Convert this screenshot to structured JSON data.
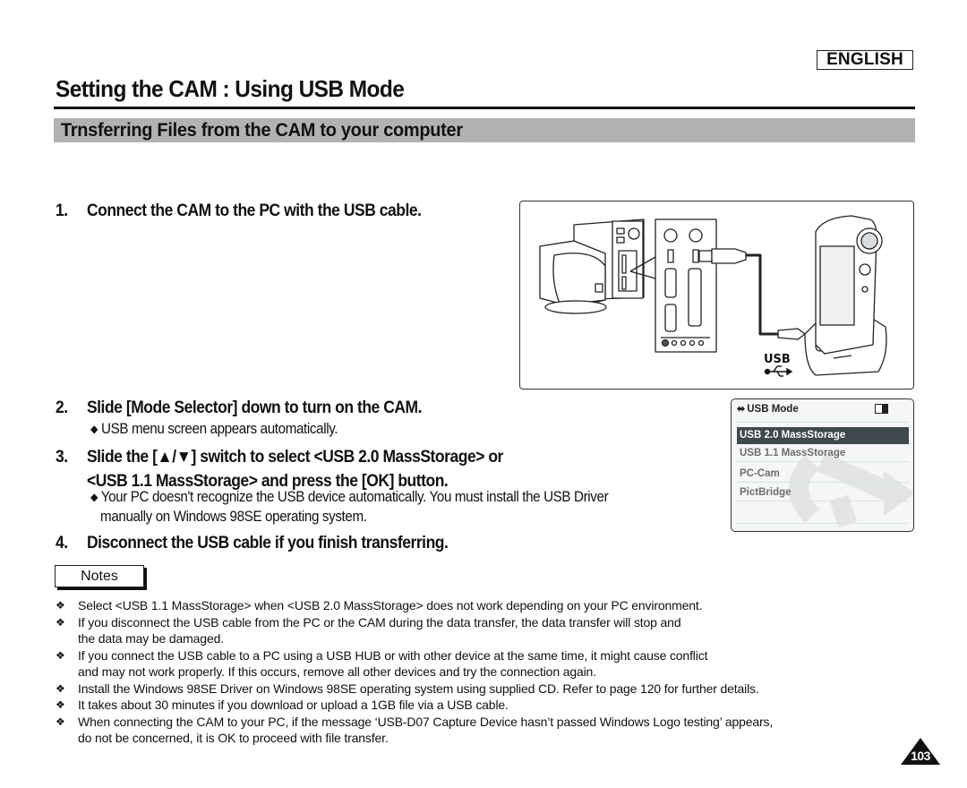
{
  "header": {
    "language": "ENGLISH",
    "page_title": "Setting the CAM : Using USB Mode",
    "section_title": "Trnsferring Files from the CAM to your computer"
  },
  "steps": [
    {
      "number": "1.",
      "lines": [
        "Connect the CAM to the PC with the USB cable."
      ],
      "notes": []
    },
    {
      "number": "2.",
      "lines": [
        "Slide [Mode Selector] down to turn on the CAM."
      ],
      "notes": [
        "USB menu screen appears automatically."
      ]
    },
    {
      "number": "3.",
      "lines": [
        "Slide the [▲/▼] switch to select <USB 2.0 MassStorage> or",
        "<USB 1.1 MassStorage> and press the [OK] button."
      ],
      "notes": [
        "Your PC doesn't recognize the USB device automatically. You must install the USB Driver",
        "manually on Windows 98SE operating system."
      ]
    },
    {
      "number": "4.",
      "lines": [
        "Disconnect the USB cable if you finish transferring."
      ],
      "notes": []
    }
  ],
  "sub_bullet_glyph": "◆",
  "figure": {
    "usb_label": "USB",
    "usb_icon": "usb-trident-icon"
  },
  "lcd": {
    "header_icon": "usb-icon",
    "header_title": "USB Mode",
    "status_icon": "dc-in-icon",
    "items": [
      {
        "label": "USB 2.0 MassStorage",
        "selected": true
      },
      {
        "label": "USB 1.1 MassStorage",
        "selected": false
      },
      {
        "label": "PC-Cam",
        "selected": false
      },
      {
        "label": "PictBridge",
        "selected": false
      }
    ]
  },
  "notes": {
    "label": "Notes",
    "bullet_glyph": "❖",
    "items": [
      [
        "Select <USB 1.1 MassStorage> when <USB 2.0 MassStorage> does not work depending on your PC environment."
      ],
      [
        "If you disconnect the USB cable from the PC or the CAM during the data transfer, the data transfer will stop and",
        "the data may be damaged."
      ],
      [
        "If you connect the USB cable to a PC using a USB HUB or with other device at the same time, it might cause conflict",
        "and may not work properly. If this occurs, remove all other devices and try the connection again."
      ],
      [
        "Install the Windows 98SE Driver on Windows 98SE operating system using supplied CD. Refer to page 120 for further details."
      ],
      [
        "It takes about 30 minutes if you download or upload a 1GB file via a USB cable."
      ],
      [
        "When connecting the CAM to your PC, if the message ‘USB-D07 Capture Device hasn’t passed Windows Logo testing’ appears,",
        "do not be concerned, it is OK to proceed with file transfer."
      ]
    ]
  },
  "footer": {
    "page_number": "103"
  }
}
